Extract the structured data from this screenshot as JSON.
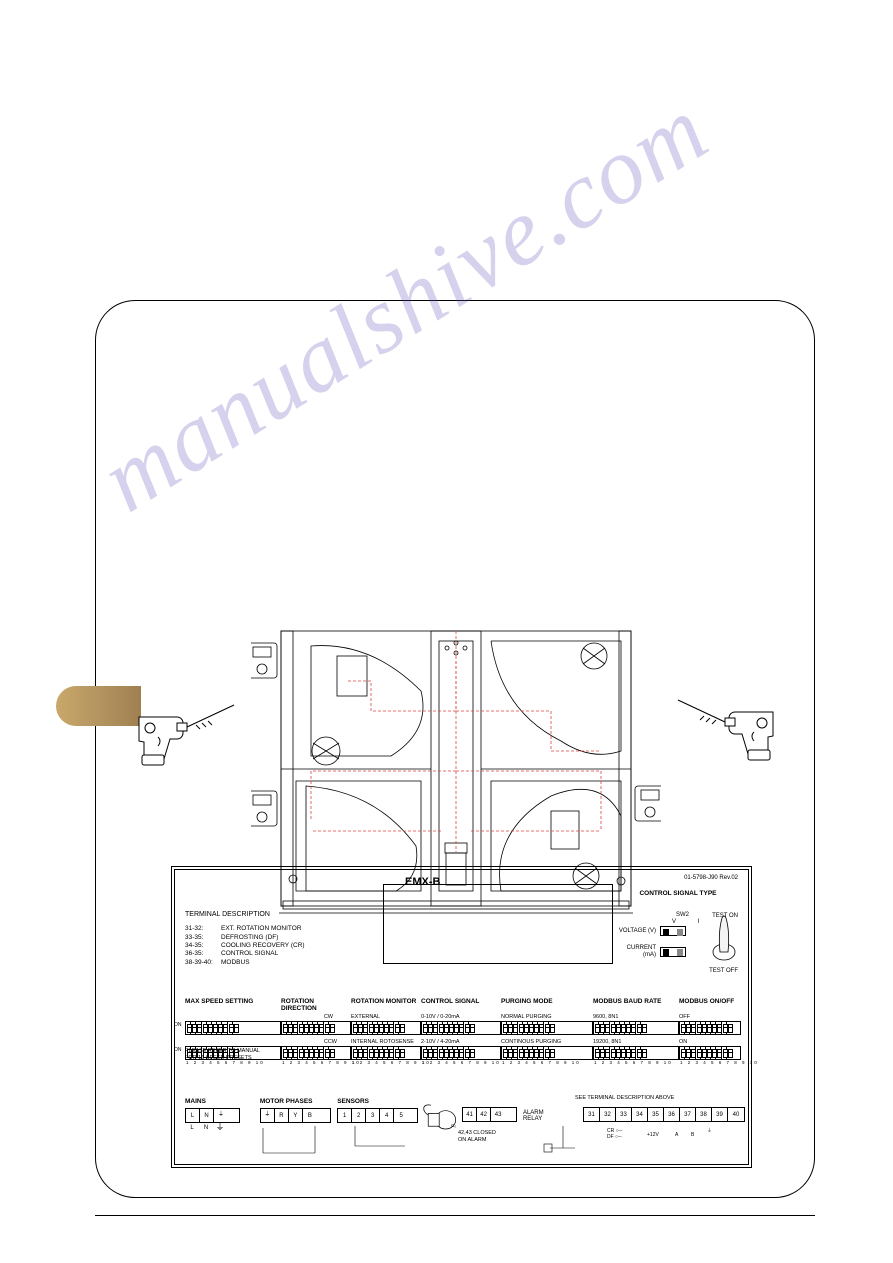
{
  "panel": {
    "title": "EMX-B",
    "doc_no": "01-5798-J90 Rev.02",
    "terminal_description": {
      "heading": "TERMINAL DESCRIPTION",
      "rows": [
        {
          "k": "31-32:",
          "v": "EXT. ROTATION MONITOR"
        },
        {
          "k": "33-35:",
          "v": "DEFROSTING (DF)"
        },
        {
          "k": "34-35:",
          "v": "COOLING RECOVERY (CR)"
        },
        {
          "k": "36-35:",
          "v": "CONTROL SIGNAL"
        },
        {
          "k": "38-39-40:",
          "v": "MODBUS"
        }
      ]
    },
    "control_signal_type": {
      "heading": "CONTROL SIGNAL TYPE",
      "sw2": "SW2",
      "vi": "V    I",
      "voltage": "VOLTAGE (V)",
      "current": "CURRENT (mA)",
      "test_on": "TEST ON",
      "test_off": "TEST OFF"
    },
    "dip": {
      "cols": {
        "maxspeed": "MAX SPEED SETTING",
        "rotdir": "ROTATION DIRECTION",
        "rotmon": "ROTATION MONITOR",
        "ctrlsig": "CONTROL SIGNAL",
        "purge": "PURGING MODE",
        "baud": "MODBUS BAUD RATE",
        "modonoff": "MODBUS ON/OFF"
      },
      "row1": {
        "rotdir": "CW",
        "rotmon": "EXTERNAL",
        "ctrlsig": "0-10V / 0-20mA",
        "purge": "NORMAL PURGING",
        "baud": "9600, 8N1",
        "modonoff": "OFF"
      },
      "row2": {
        "rotdir": "CCW",
        "rotmon": "INTERNAL ROTOSENSE",
        "ctrlsig": "2-10V / 4-20mA",
        "purge": "CONTINOUS PURGING",
        "baud": "19200, 8N1",
        "modonoff": "ON"
      },
      "nums": "1 2 3 4 5 6 7 8 9 10",
      "on": "ON"
    },
    "speed_note": "PLEASE REFER TO MANUAL FOR 16 SPEED PRESETS",
    "bottom": {
      "mains": "MAINS",
      "mains_L": "L",
      "mains_N": "N",
      "motor": "MOTOR PHASES",
      "motor_R": "R",
      "motor_Y": "Y",
      "motor_B": "B",
      "sensors": "SENSORS",
      "sensor_ids": [
        "1",
        "2",
        "3",
        "4",
        "5"
      ],
      "alarm_terminals": [
        "41",
        "42",
        "43"
      ],
      "alarm_label": "ALARM RELAY",
      "alarm_note_1": "42,43 CLOSED",
      "alarm_note_2": "ON ALARM",
      "right_terms": [
        "31",
        "32",
        "33",
        "34",
        "35",
        "36",
        "37",
        "38",
        "39",
        "40"
      ],
      "right_sub": {
        "cr": "CR",
        "df": "DF",
        "p12": "+12V",
        "A": "A",
        "B": "B"
      },
      "right_note": "SEE TERMINAL DESCRIPTION ABOVE"
    }
  },
  "watermark": "manualshive.com"
}
